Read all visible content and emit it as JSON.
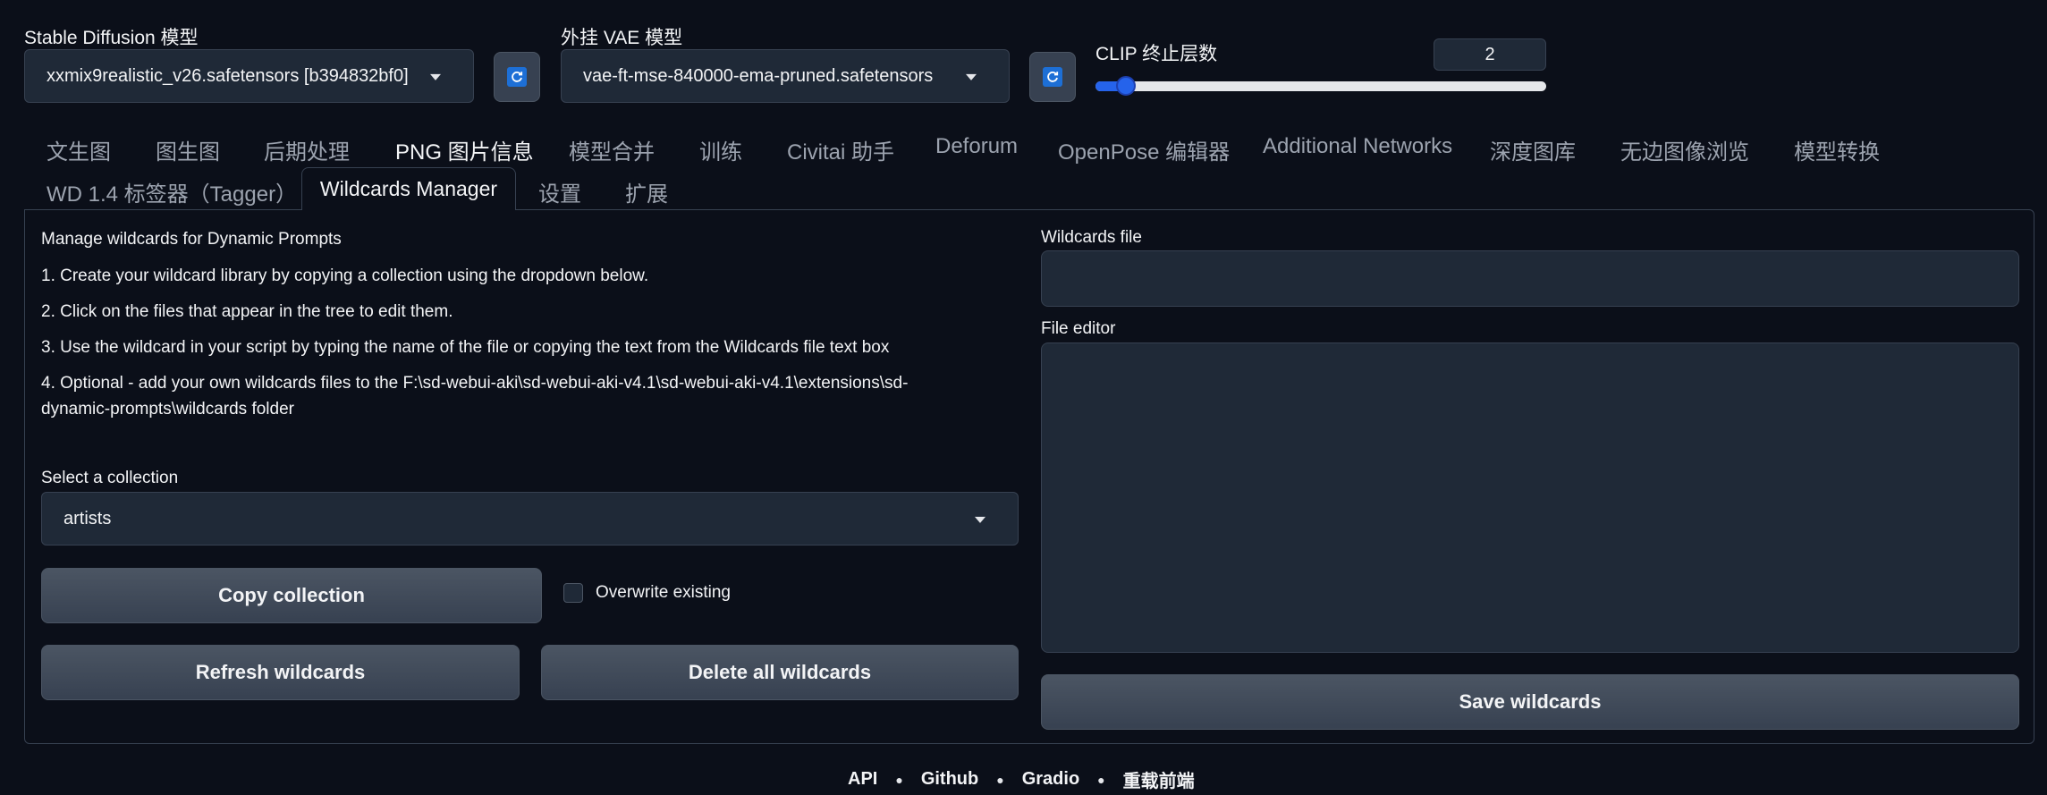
{
  "models": {
    "sd_label": "Stable Diffusion 模型",
    "sd_value": "xxmix9realistic_v26.safetensors [b394832bf0]",
    "vae_label": "外挂 VAE 模型",
    "vae_value": "vae-ft-mse-840000-ema-pruned.safetensors",
    "clip_label": "CLIP 终止层数",
    "clip_value": "2",
    "clip_slider_fraction": 0.05
  },
  "tabs_row1": [
    "文生图",
    "图生图",
    "后期处理",
    "PNG 图片信息",
    "模型合并",
    "训练",
    "Civitai 助手",
    "Deforum",
    "OpenPose 编辑器",
    "Additional Networks",
    "深度图库",
    "无边图像浏览",
    "模型转换"
  ],
  "tabs_row2": [
    "WD 1.4 标签器（Tagger）",
    "Wildcards Manager",
    "设置",
    "扩展"
  ],
  "selected_tab": "Wildcards Manager",
  "manager": {
    "heading": "Manage wildcards for Dynamic Prompts",
    "step1": "1. Create your wildcard library by copying a collection using the dropdown below.",
    "step2": "2. Click on the files that appear in the tree to edit them.",
    "step3": "3. Use the wildcard in your script by typing the name of the file or copying the text from the Wildcards file text box",
    "step4_line1": "4. Optional - add your own wildcards files to the F:\\sd-webui-aki\\sd-webui-aki-v4.1\\sd-webui-aki-v4.1\\extensions\\sd-",
    "step4_line2": "dynamic-prompts\\wildcards folder",
    "collection_label": "Select a collection",
    "collection_value": "artists",
    "copy_button": "Copy collection",
    "overwrite_label": "Overwrite existing",
    "refresh_button": "Refresh wildcards",
    "delete_button": "Delete all wildcards",
    "wildcards_file_label": "Wildcards file",
    "file_editor_label": "File editor",
    "save_button": "Save wildcards"
  },
  "footer": {
    "api": "API",
    "github": "Github",
    "gradio": "Gradio",
    "reload": "重载前端"
  }
}
